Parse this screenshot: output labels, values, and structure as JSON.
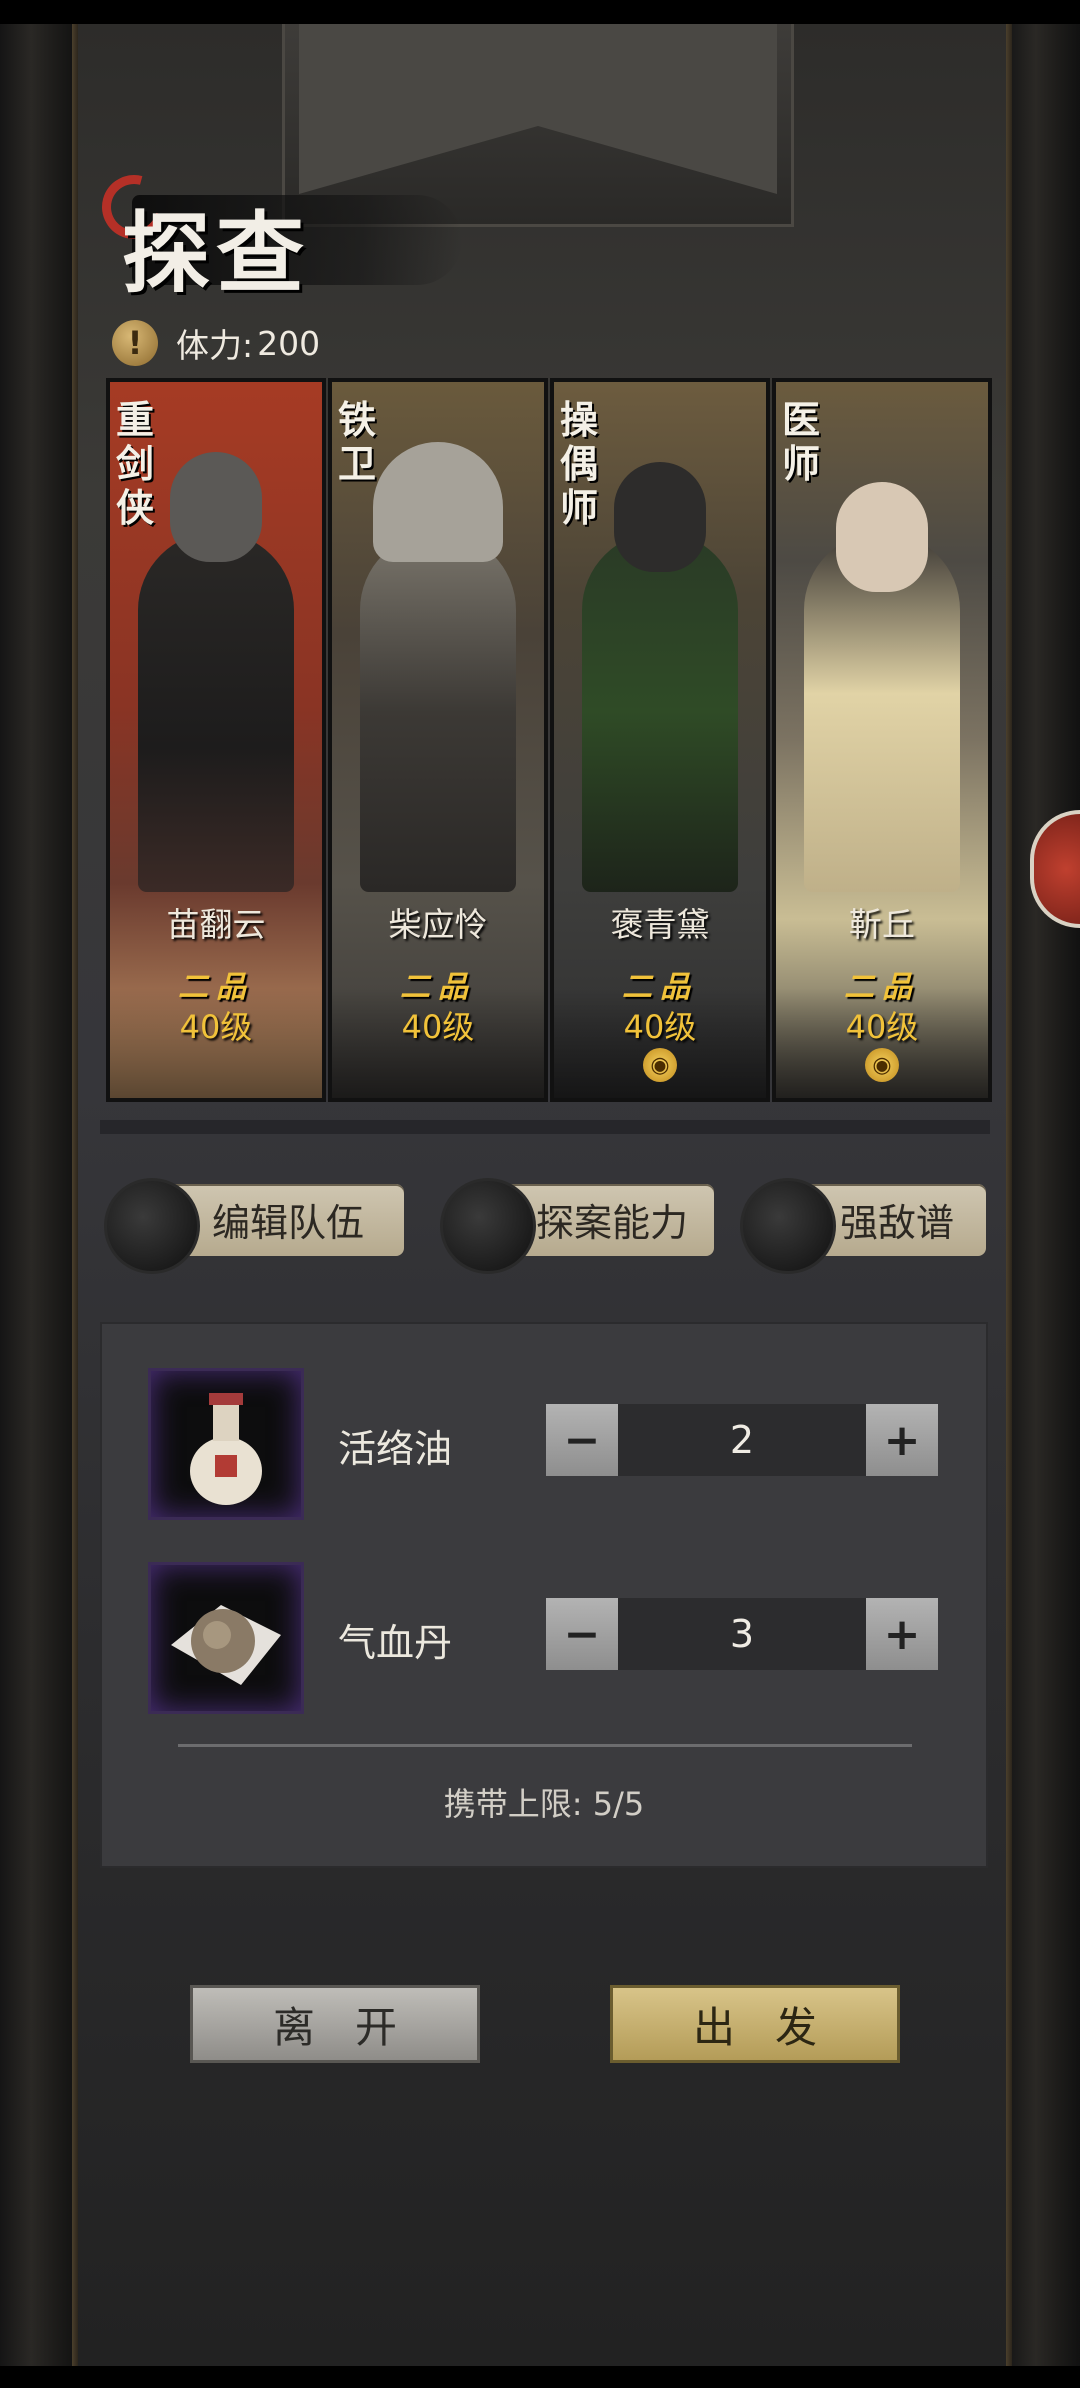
{
  "page": {
    "title": "探查"
  },
  "stamina": {
    "label": "体力:",
    "value": "200"
  },
  "heroes": [
    {
      "role": "重剑侠",
      "name": "苗翻云",
      "rank": "二品",
      "level": "40级",
      "has_badge": false
    },
    {
      "role": "铁卫",
      "name": "柴应怜",
      "rank": "二品",
      "level": "40级",
      "has_badge": false
    },
    {
      "role": "操偶师",
      "name": "褒青黛",
      "rank": "二品",
      "level": "40级",
      "has_badge": true
    },
    {
      "role": "医师",
      "name": "靳丘",
      "rank": "二品",
      "level": "40级",
      "has_badge": true
    }
  ],
  "actions": {
    "edit_team": "编辑队伍",
    "investigate_ability": "探案能力",
    "enemy_list": "强敌谱"
  },
  "items": [
    {
      "name": "活络油",
      "quantity": "2",
      "icon": "potion-bottle-icon"
    },
    {
      "name": "气血丹",
      "quantity": "3",
      "icon": "pill-icon"
    }
  ],
  "stepper": {
    "minus": "−",
    "plus": "+"
  },
  "carry_limit": {
    "label": "携带上限:",
    "value": "5/5"
  },
  "buttons": {
    "leave": "离开",
    "depart": "出发"
  },
  "colors": {
    "gold": "#f1c23a",
    "accent_red": "#b53027",
    "item_frame": "#4b2f7a"
  }
}
